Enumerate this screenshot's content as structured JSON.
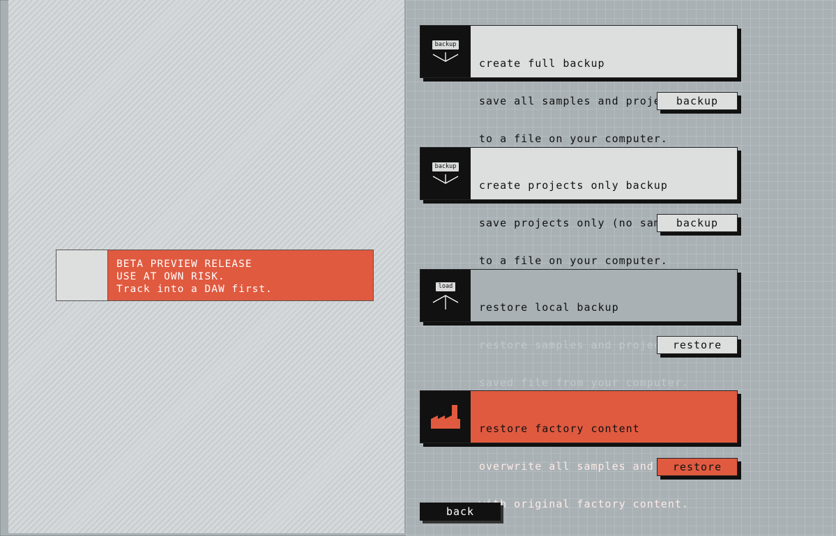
{
  "notice": {
    "line1": "BETA PREVIEW RELEASE",
    "line2": "USE AT OWN RISK.",
    "line3": "Track into a DAW first."
  },
  "cards": [
    {
      "icon_tag": "backup",
      "icon": "download-arrow-icon",
      "title": "create full backup",
      "line2": "save all samples and projects",
      "line3": "to a file on your computer.",
      "button": "backup"
    },
    {
      "icon_tag": "backup",
      "icon": "download-arrow-icon",
      "title": "create projects only backup",
      "line2": "save projects only (no samples)",
      "line3": "to a file on your computer.",
      "button": "backup"
    },
    {
      "icon_tag": "load",
      "icon": "upload-arrow-icon",
      "title": "restore local backup",
      "line2": "restore samples and projects with",
      "line3": "saved file from your computer.",
      "button": "restore"
    },
    {
      "icon_tag": "",
      "icon": "factory-icon",
      "title": "restore factory content",
      "line2": "overwrite all samples and projects",
      "line3": "with original factory content.",
      "button": "restore"
    }
  ],
  "back_label": "back",
  "colors": {
    "accent": "#e05a40",
    "dark": "#111111",
    "light": "#dcdfdd",
    "panel": "#a9b1b5"
  }
}
